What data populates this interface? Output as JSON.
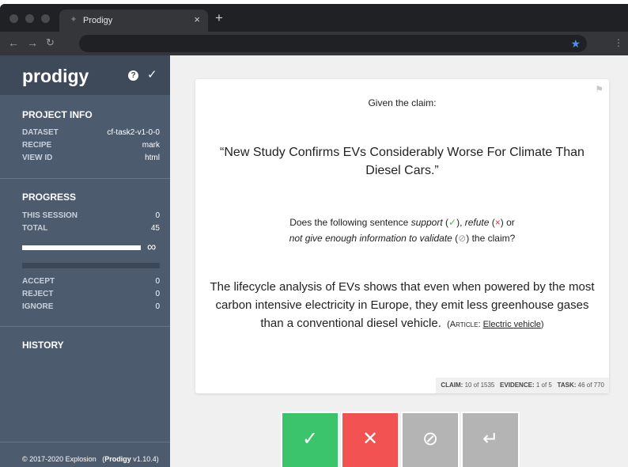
{
  "browser": {
    "tab_title": "Prodigy",
    "tab_close": "×",
    "new_tab": "+",
    "address": "",
    "icons": [
      "back-icon",
      "forward-icon",
      "reload-icon",
      "star-icon"
    ]
  },
  "sidebar": {
    "logo": "prodigy",
    "project_info": {
      "title": "PROJECT INFO",
      "rows": [
        {
          "label": "DATASET",
          "value": "cf-task2-v1-0-0"
        },
        {
          "label": "RECIPE",
          "value": "mark"
        },
        {
          "label": "VIEW ID",
          "value": "html"
        }
      ]
    },
    "progress": {
      "title": "PROGRESS",
      "session": {
        "label": "THIS SESSION",
        "value": "0"
      },
      "total": {
        "label": "TOTAL",
        "value": "45"
      },
      "infinity": "∞",
      "session_fraction": 1.0,
      "counts": [
        {
          "label": "ACCEPT",
          "value": "0"
        },
        {
          "label": "REJECT",
          "value": "0"
        },
        {
          "label": "IGNORE",
          "value": "0"
        }
      ]
    },
    "history": {
      "title": "HISTORY"
    },
    "footer": {
      "copyright": "© 2017-2020 Explosion",
      "app_name": "Prodigy",
      "version": "v1.10.4"
    }
  },
  "task": {
    "prompt": "Given the claim:",
    "claim": "“New Study Confirms EVs Considerably Worse For Climate Than Diesel Cars.”",
    "question": {
      "part1": "Does the following sentence ",
      "support": "support",
      "support_mark": "✓",
      "part2": ", ",
      "refute": "refute",
      "refute_mark": "×",
      "part3": " or",
      "not_enough": "not give enough information to validate",
      "not_enough_mark": "⊘",
      "part4": " the claim?"
    },
    "evidence": "The lifecycle analysis of EVs shows that even when powered by the most carbon intensive electricity in Europe, they emit less greenhouse gases than a conventional diesel vehicle.",
    "article_label": "Article:",
    "article_link": "Electric vehicle",
    "meta": {
      "claim_label": "CLAIM:",
      "claim_value": "10 of 1535",
      "evidence_label": "EVIDENCE:",
      "evidence_value": "1 of 5",
      "task_label": "TASK:",
      "task_value": "46 of 770"
    }
  },
  "actions": {
    "accept": "✓",
    "reject": "✕",
    "ignore": "⊘",
    "undo": "↵"
  },
  "colors": {
    "sidebar": "#4d5b6e",
    "sidebar_header": "#3e4a5a",
    "accept": "#3bc46b",
    "reject": "#f25252",
    "ignore": "#b4b4b4"
  }
}
